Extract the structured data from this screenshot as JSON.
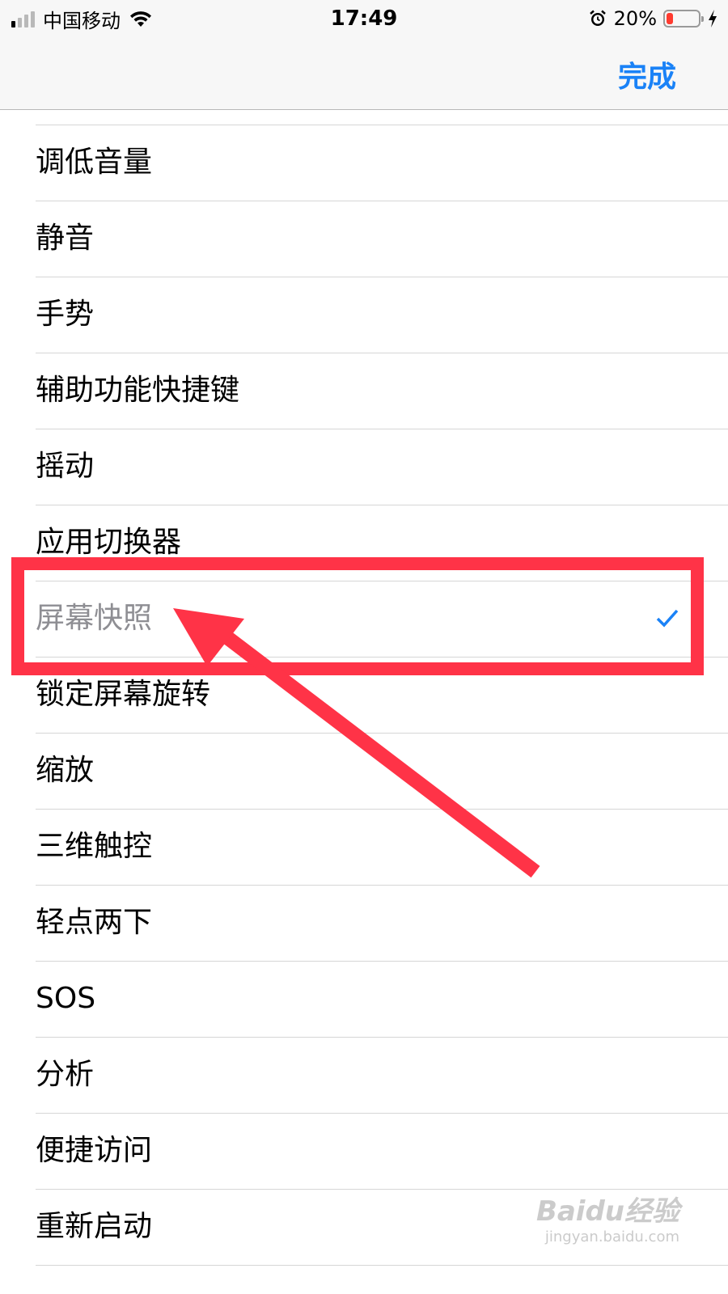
{
  "status_bar": {
    "carrier": "中国移动",
    "time": "17:49",
    "battery_percent_text": "20%",
    "battery_level": 0.2,
    "signal_bars": 4,
    "signal_active": 1
  },
  "nav": {
    "done_label": "完成"
  },
  "colors": {
    "accent": "#1a82f7",
    "annotation": "#ff3347",
    "battery_low": "#ff3b30"
  },
  "list": {
    "items": [
      {
        "label": "调低音量"
      },
      {
        "label": "静音"
      },
      {
        "label": "手势"
      },
      {
        "label": "辅助功能快捷键"
      },
      {
        "label": "摇动"
      },
      {
        "label": "应用切换器"
      },
      {
        "label": "屏幕快照",
        "selected": true
      },
      {
        "label": "锁定屏幕旋转"
      },
      {
        "label": "缩放"
      },
      {
        "label": "三维触控"
      },
      {
        "label": "轻点两下"
      },
      {
        "label": "SOS"
      },
      {
        "label": "分析"
      },
      {
        "label": "便捷访问"
      },
      {
        "label": "重新启动"
      }
    ]
  },
  "watermark": {
    "main": "Baidu经验",
    "sub": "jingyan.baidu.com"
  }
}
